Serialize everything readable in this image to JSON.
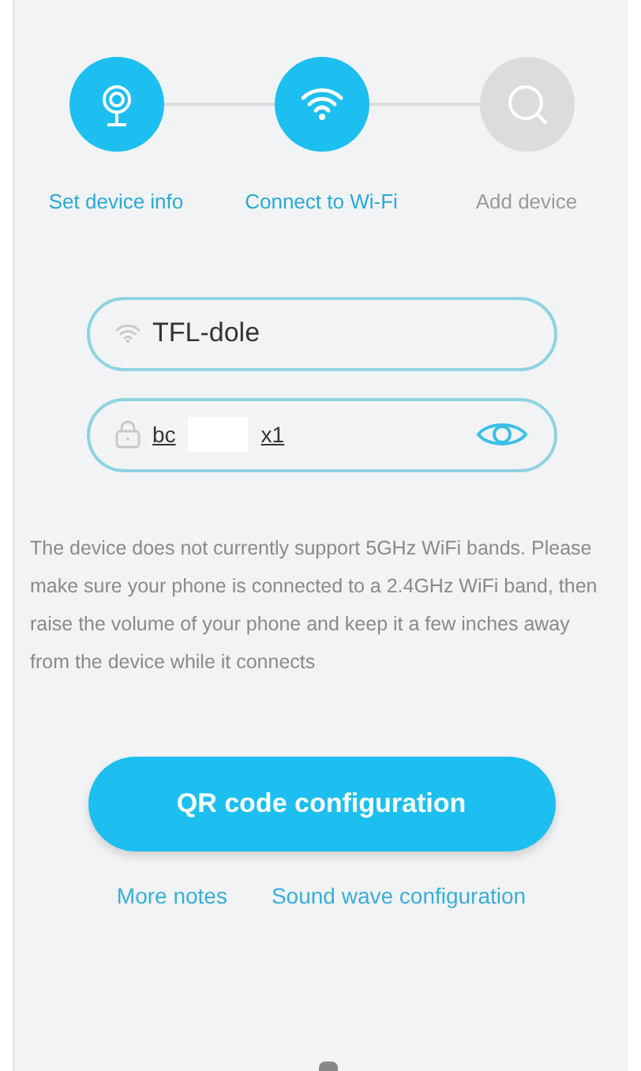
{
  "steps": [
    {
      "label": "Set device info",
      "kind": "camera",
      "completed": true
    },
    {
      "label": "Connect to Wi-Fi",
      "kind": "wifi",
      "completed": true
    },
    {
      "label": "Add device",
      "kind": "search",
      "completed": false
    }
  ],
  "wifi_field": {
    "value": "TFL-dole"
  },
  "password_field": {
    "value_start": "bc",
    "value_end": "x1",
    "redacted": true
  },
  "notice": "The device does not currently support 5GHz WiFi bands. Please make sure your phone is connected to a 2.4GHz WiFi band, then raise the volume of your phone and keep it a few inches away from the device while it connects",
  "primary_button": "QR code configuration",
  "links": [
    "More notes",
    "Sound wave configuration"
  ]
}
